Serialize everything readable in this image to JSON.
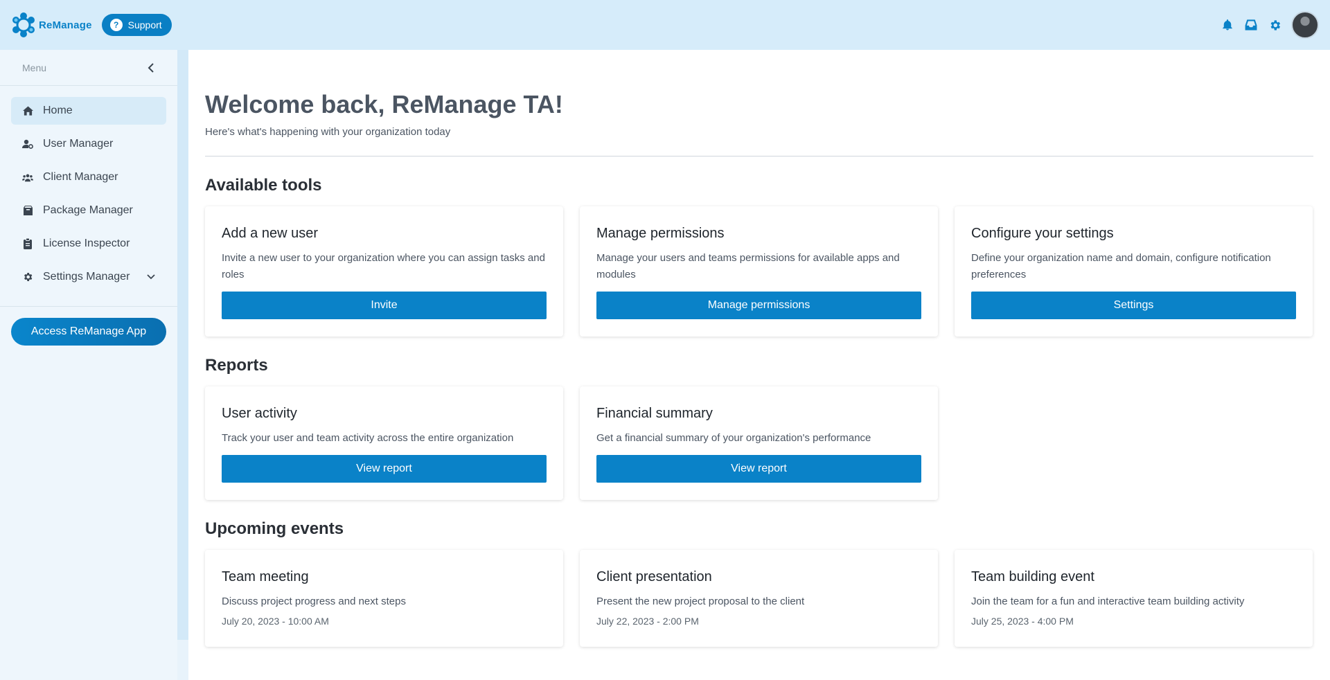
{
  "header": {
    "brand": "ReManage",
    "support_label": "Support"
  },
  "sidebar": {
    "menu_label": "Menu",
    "items": [
      {
        "label": "Home",
        "icon": "home-icon",
        "active": true
      },
      {
        "label": "User Manager",
        "icon": "user-gear-icon"
      },
      {
        "label": "Client Manager",
        "icon": "users-icon"
      },
      {
        "label": "Package Manager",
        "icon": "package-icon"
      },
      {
        "label": "License Inspector",
        "icon": "clipboard-icon"
      },
      {
        "label": "Settings Manager",
        "icon": "gear-icon",
        "expandable": true
      }
    ],
    "access_app_label": "Access ReManage App"
  },
  "main": {
    "title": "Welcome back, ReManage TA!",
    "subtitle": "Here's what's happening with your organization today",
    "tools": {
      "title": "Available tools",
      "cards": [
        {
          "title": "Add a new user",
          "desc": "Invite a new user to your organization where you can assign tasks and roles",
          "button": "Invite"
        },
        {
          "title": "Manage permissions",
          "desc": "Manage your users and teams permissions for available apps and modules",
          "button": "Manage permissions"
        },
        {
          "title": "Configure your settings",
          "desc": "Define your organization name and domain, configure notification preferences",
          "button": "Settings"
        }
      ]
    },
    "reports": {
      "title": "Reports",
      "cards": [
        {
          "title": "User activity",
          "desc": "Track your user and team activity across the entire organization",
          "button": "View report"
        },
        {
          "title": "Financial summary",
          "desc": "Get a financial summary of your organization's performance",
          "button": "View report"
        }
      ]
    },
    "events": {
      "title": "Upcoming events",
      "cards": [
        {
          "title": "Team meeting",
          "desc": "Discuss project progress and next steps",
          "date": "July 20, 2023 - 10:00 AM"
        },
        {
          "title": "Client presentation",
          "desc": "Present the new project proposal to the client",
          "date": "July 22, 2023 - 2:00 PM"
        },
        {
          "title": "Team building event",
          "desc": "Join the team for a fun and interactive team building activity",
          "date": "July 25, 2023 - 4:00 PM"
        }
      ]
    }
  },
  "colors": {
    "accent": "#0a82c8",
    "topbar": "#d6ecfa",
    "sidebar": "#eef6fc"
  }
}
